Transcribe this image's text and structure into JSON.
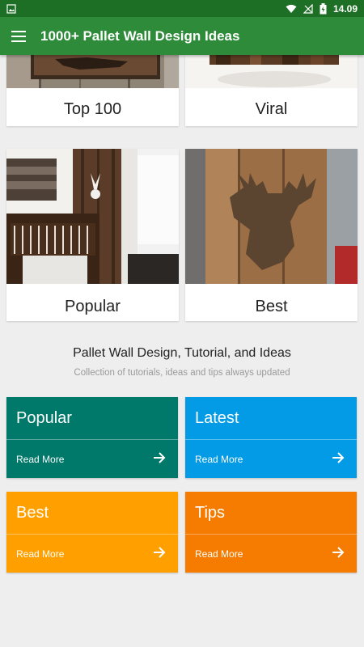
{
  "status": {
    "time": "14.09"
  },
  "appbar": {
    "title": "1000+ Pallet Wall Design Ideas"
  },
  "cards": [
    {
      "label": "Top 100"
    },
    {
      "label": "Viral"
    },
    {
      "label": "Popular"
    },
    {
      "label": "Best"
    }
  ],
  "intro": {
    "heading": "Pallet Wall Design, Tutorial, and Ideas",
    "subheading": "Collection of tutorials, ideas and tips always updated"
  },
  "tiles": [
    {
      "title": "Popular",
      "read_more": "Read More",
      "color": "#00796b"
    },
    {
      "title": "Latest",
      "read_more": "Read More",
      "color": "#039be5"
    },
    {
      "title": "Best",
      "read_more": "Read More",
      "color": "#ffa000"
    },
    {
      "title": "Tips",
      "read_more": "Read More",
      "color": "#f57c00"
    }
  ]
}
